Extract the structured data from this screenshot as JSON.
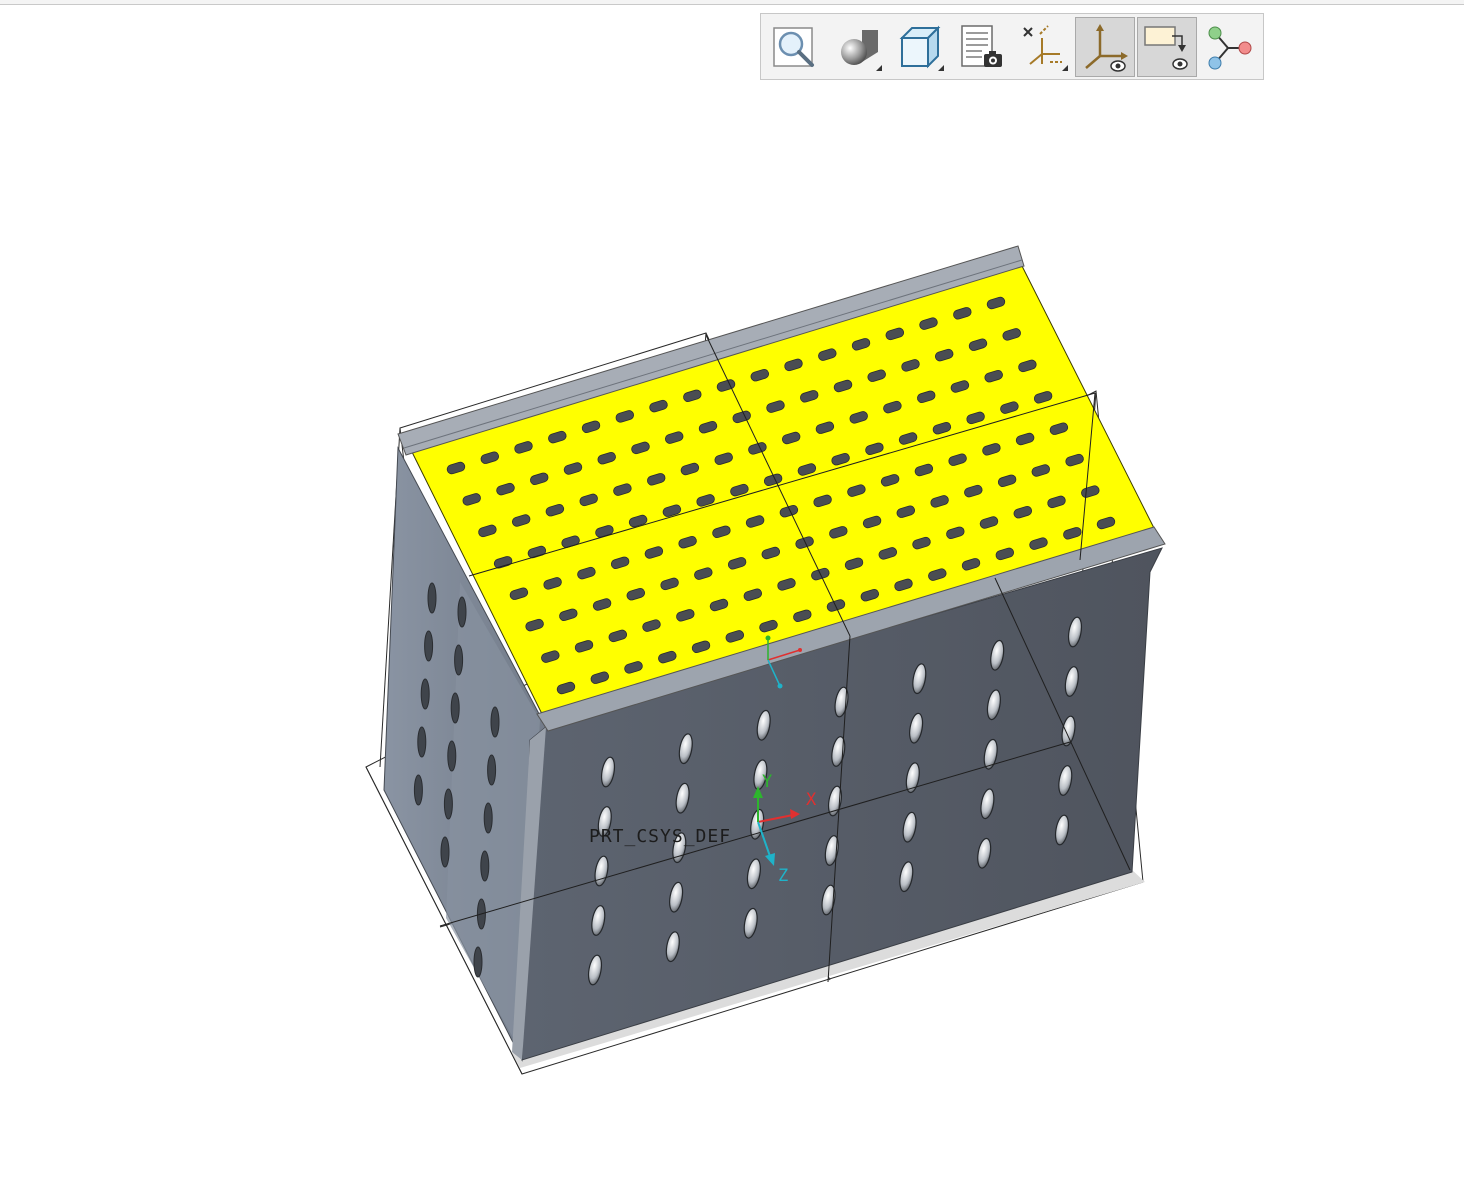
{
  "toolbar": {
    "buttons": [
      {
        "name": "refit",
        "icon": "zoom-fit-icon",
        "active": false,
        "dropdown": false
      },
      {
        "name": "display-style",
        "icon": "display-style-icon",
        "active": false,
        "dropdown": true
      },
      {
        "name": "saved-orientations",
        "icon": "saved-views-icon",
        "active": false,
        "dropdown": true
      },
      {
        "name": "view-manager",
        "icon": "view-manager-icon",
        "active": false,
        "dropdown": false
      },
      {
        "name": "datum-display-filters",
        "icon": "datum-filters-icon",
        "active": false,
        "dropdown": true
      },
      {
        "name": "csys-display",
        "icon": "csys-display-icon",
        "active": true,
        "dropdown": false
      },
      {
        "name": "annotation-display",
        "icon": "annotation-display-icon",
        "active": true,
        "dropdown": false
      },
      {
        "name": "spin-center",
        "icon": "spin-center-icon",
        "active": false,
        "dropdown": false
      }
    ]
  },
  "model": {
    "csys_label": "PRT_CSYS_DEF",
    "axis_x": "X",
    "axis_y": "Y",
    "axis_z": "Z",
    "colors": {
      "top_surface": "#ffff00",
      "front_face": "#565b65",
      "side_face": "#7e8795",
      "flange": "#9ea5af"
    }
  }
}
